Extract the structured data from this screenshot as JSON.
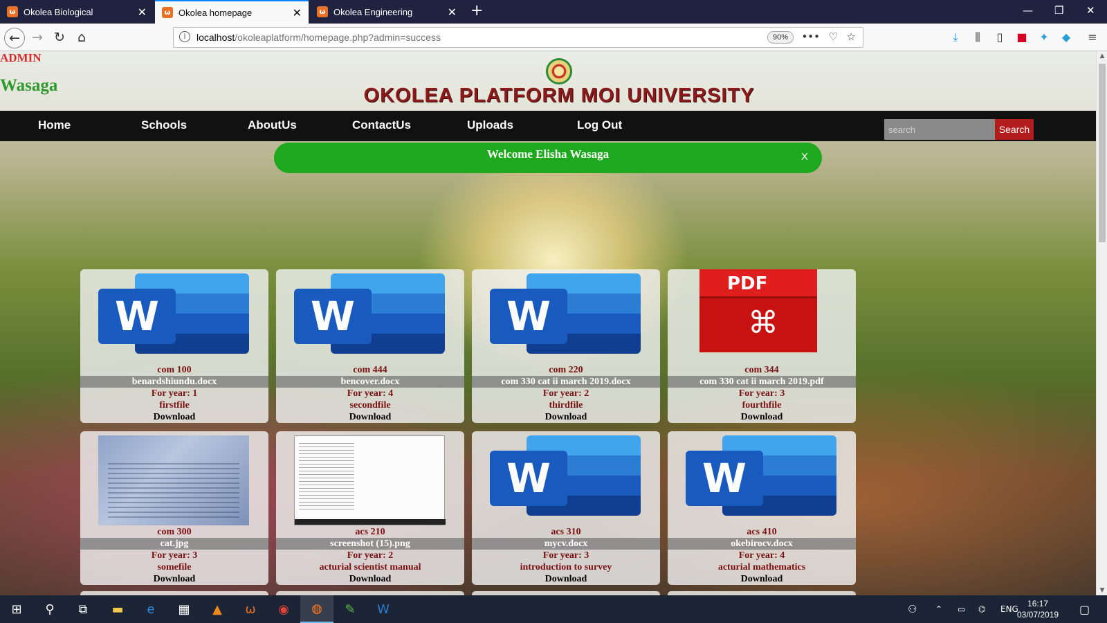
{
  "browser": {
    "tabs": [
      {
        "title": "Okolea Biological",
        "active": false
      },
      {
        "title": "Okolea homepage",
        "active": true
      },
      {
        "title": "Okolea Engineering",
        "active": false
      }
    ],
    "url_host": "localhost",
    "url_path": "/okoleaplatform/homepage.php?admin=success",
    "zoom": "90%"
  },
  "header": {
    "role": "ADMIN",
    "username": "Wasaga",
    "site_title": "OKOLEA PLATFORM MOI UNIVERSITY"
  },
  "nav": {
    "items": [
      "Home",
      "Schools",
      "AboutUs",
      "ContactUs",
      "Uploads",
      "Log Out"
    ],
    "search_placeholder": "search",
    "search_button": "Search"
  },
  "welcome": {
    "message": "Welcome Elisha Wasaga",
    "close": "X"
  },
  "files": [
    {
      "course": "com 100",
      "filename": "benardshiundu.docx",
      "year": "For year: 1",
      "description": "firstfile",
      "action": "Download",
      "thumb": "word"
    },
    {
      "course": "com 444",
      "filename": "bencover.docx",
      "year": "For year: 4",
      "description": "secondfile",
      "action": "Download",
      "thumb": "word"
    },
    {
      "course": "com 220",
      "filename": "com 330 cat ii march 2019.docx",
      "year": "For year: 2",
      "description": "thirdfile",
      "action": "Download",
      "thumb": "word"
    },
    {
      "course": "com 344",
      "filename": "com 330 cat ii march 2019.pdf",
      "year": "For year: 3",
      "description": "fourthfile",
      "action": "Download",
      "thumb": "pdf"
    },
    {
      "course": "com 300",
      "filename": "cat.jpg",
      "year": "For year: 3",
      "description": "somefile",
      "action": "Download",
      "thumb": "photo"
    },
    {
      "course": "acs 210",
      "filename": "screenshot (15).png",
      "year": "For year: 2",
      "description": "acturial scientist manual",
      "action": "Download",
      "thumb": "screenshot"
    },
    {
      "course": "acs 310",
      "filename": "mycv.docx",
      "year": "For year: 3",
      "description": "introduction to survey",
      "action": "Download",
      "thumb": "word"
    },
    {
      "course": "acs 410",
      "filename": "okebirocv.docx",
      "year": "For year: 4",
      "description": "acturial mathematics",
      "action": "Download",
      "thumb": "word"
    }
  ],
  "thumb_labels": {
    "word_letter": "W",
    "pdf_label": "PDF"
  },
  "taskbar": {
    "language": "ENG",
    "time": "16:17",
    "date": "03/07/2019"
  },
  "colors": {
    "nav_bg": "#111111",
    "welcome_bg": "#1ea81e",
    "title_color": "#8b1a1a",
    "search_button_bg": "#b21c1c"
  }
}
